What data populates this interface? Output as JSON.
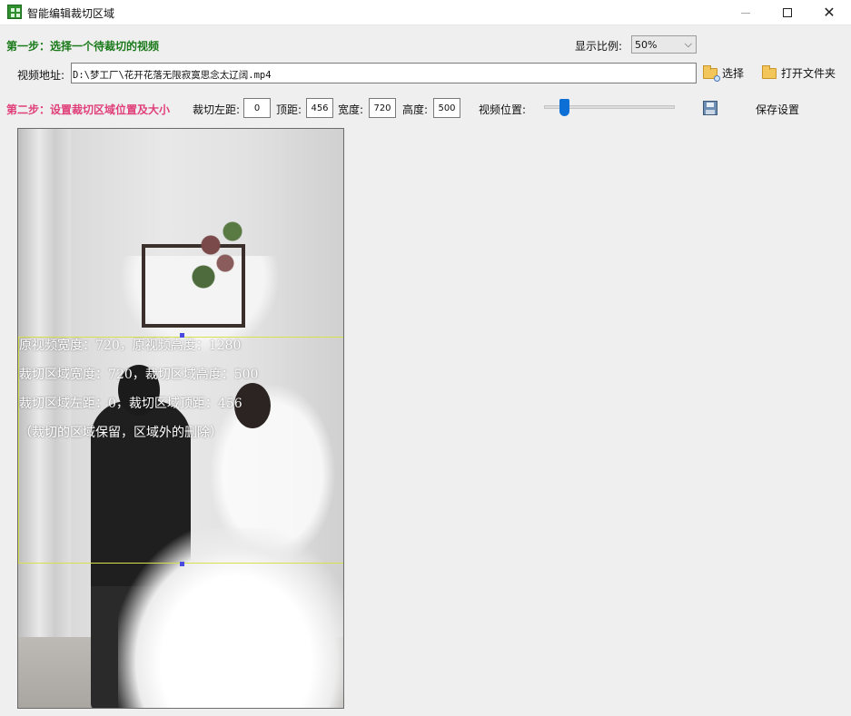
{
  "window": {
    "title": "智能编辑裁切区域",
    "controls": {
      "minimize": "—",
      "maximize": "☐",
      "close": "✕"
    }
  },
  "step1": {
    "label": "第一步：选择一个待裁切的视频",
    "ratio_label": "显示比例:",
    "ratio_value": "50%",
    "address_label": "视频地址:",
    "address_value": "D:\\梦工厂\\花开花落无限寂寞思念太辽阔.mp4",
    "select_button": "选择",
    "open_folder_button": "打开文件夹"
  },
  "step2": {
    "label": "第二步：设置裁切区域位置及大小",
    "left_label": "裁切左距:",
    "left_value": "0",
    "top_label": "顶距:",
    "top_value": "456",
    "width_label": "宽度:",
    "width_value": "720",
    "height_label": "高度:",
    "height_value": "500",
    "video_position_label": "视频位置:",
    "save_settings_button": "保存设置"
  },
  "preview": {
    "info_lines": [
      "原视频宽度：720，原视频高度：1280",
      "裁切区域宽度：720，裁切区域高度：500",
      "裁切区域左距：0，裁切区域顶距：456",
      "（裁切的区域保留，区域外的删除）"
    ]
  },
  "colors": {
    "step1_color": "#1a7a1a",
    "step2_color": "#e03f7a",
    "crop_border": "#d8e04a",
    "slider_thumb": "#0b6fd6"
  },
  "icons": [
    "app-icon",
    "minimize-icon",
    "maximize-icon",
    "close-icon",
    "folder-search-icon",
    "folder-icon",
    "save-icon"
  ]
}
